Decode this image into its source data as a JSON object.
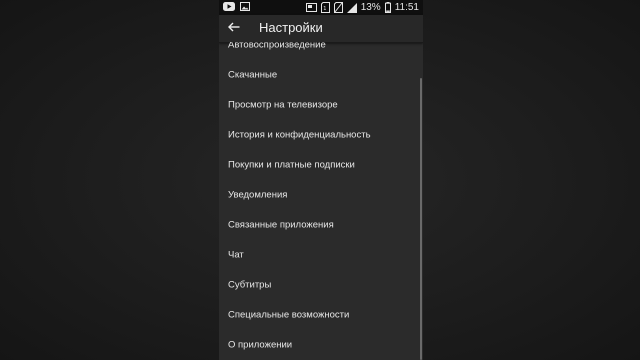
{
  "status_bar": {
    "icons_left": [
      "youtube-icon",
      "image-icon"
    ],
    "icons_right": [
      "cast-icon",
      "sim-icon",
      "no-sim-icon",
      "signal-icon"
    ],
    "battery": "13%",
    "battery_icon": "battery-icon",
    "time": "11:51"
  },
  "header": {
    "back_icon": "arrow-left-icon",
    "title": "Настройки"
  },
  "settings": {
    "items": [
      {
        "label": "Автовоспроизведение"
      },
      {
        "label": "Скачанные"
      },
      {
        "label": "Просмотр на телевизоре"
      },
      {
        "label": "История и конфиденциальность"
      },
      {
        "label": "Покупки и платные подписки"
      },
      {
        "label": "Уведомления"
      },
      {
        "label": "Связанные приложения"
      },
      {
        "label": "Чат"
      },
      {
        "label": "Субтитры"
      },
      {
        "label": "Специальные возможности"
      },
      {
        "label": "О приложении"
      }
    ]
  },
  "colors": {
    "background": "#1f1f1f",
    "panel": "#2b2b2b",
    "status_bar": "#0f0f0f",
    "text": "#e8e8e8"
  }
}
